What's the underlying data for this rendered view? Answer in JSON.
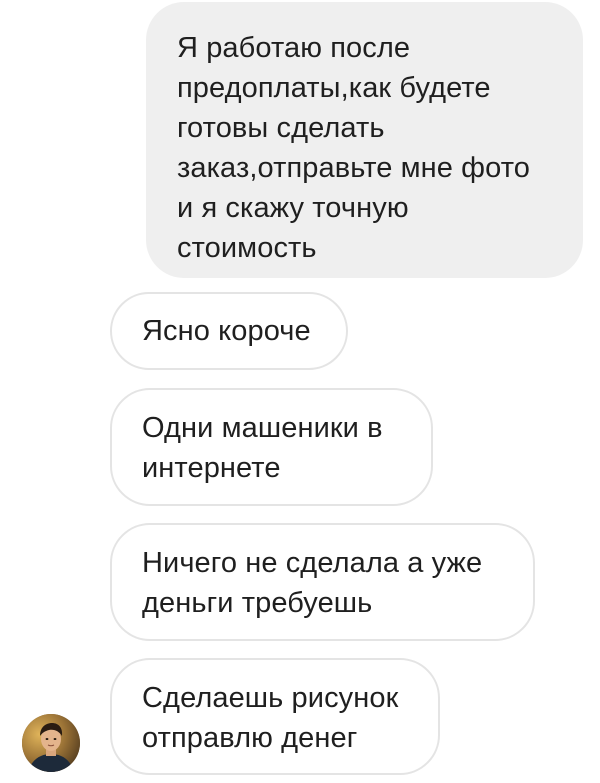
{
  "conversation": {
    "outgoing": [
      {
        "text": "Я работаю после\nпредоплаты,как будете\nготовы сделать\nзаказ,отправьте мне фото\nи я скажу точную\nстоимость"
      }
    ],
    "incoming": [
      {
        "text": "Ясно короче"
      },
      {
        "text": "Одни машеники в\nинтернете"
      },
      {
        "text": "Ничего не сделала а уже\nденьги требуешь"
      },
      {
        "text": "Сделаешь рисунок\nотправлю денег"
      }
    ],
    "sender_avatar": {
      "icon": "user-avatar-photo"
    }
  },
  "colors": {
    "outgoing_bubble_bg": "#efefef",
    "incoming_bubble_border": "#e4e4e4",
    "text": "#1f1f1f",
    "background": "#ffffff"
  }
}
